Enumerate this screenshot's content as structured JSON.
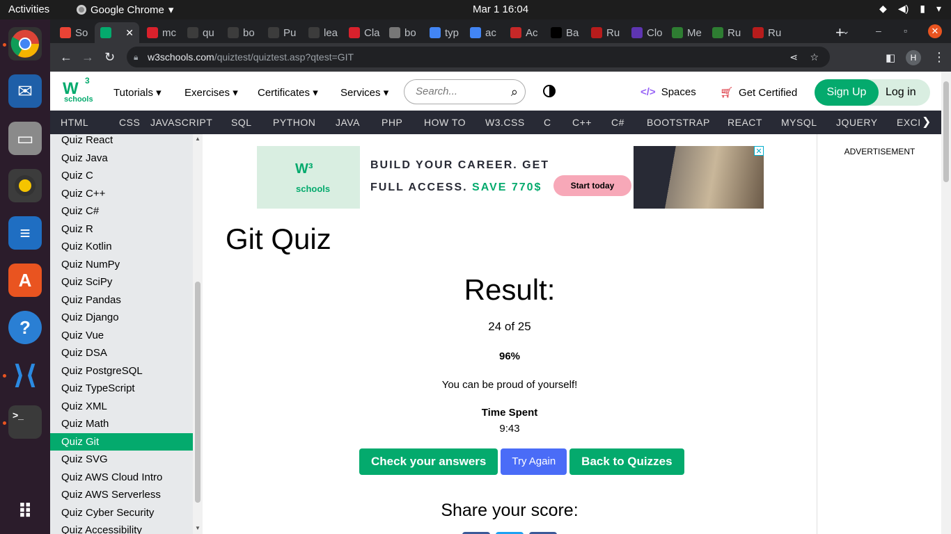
{
  "os_bar": {
    "activities": "Activities",
    "app_name": "Google Chrome",
    "clock": "Mar 1  16:04"
  },
  "dock": {
    "items": [
      "chrome",
      "thunderbird",
      "files",
      "rhythmbox",
      "writer",
      "app-center",
      "help",
      "vscode",
      "terminal",
      "show-apps"
    ]
  },
  "tabs": [
    {
      "label": "So",
      "icon": "gmail-icon",
      "color": "#ea4335"
    },
    {
      "label": "",
      "icon": "w3schools-icon",
      "color": "#04aa6d",
      "active": true
    },
    {
      "label": "mc",
      "icon": "red-cap-icon",
      "color": "#d9212c"
    },
    {
      "label": "qu",
      "icon": "github-icon",
      "color": "#3c3c3c"
    },
    {
      "label": "bo",
      "icon": "github-icon",
      "color": "#3c3c3c"
    },
    {
      "label": "Pu",
      "icon": "github-icon",
      "color": "#3c3c3c"
    },
    {
      "label": "lea",
      "icon": "github-icon",
      "color": "#3c3c3c"
    },
    {
      "label": "Cla",
      "icon": "red-cap-icon",
      "color": "#d9212c"
    },
    {
      "label": "bo",
      "icon": "globe-icon",
      "color": "#777777"
    },
    {
      "label": "typ",
      "icon": "google-icon",
      "color": "#4285f4"
    },
    {
      "label": "ac",
      "icon": "google-icon",
      "color": "#4285f4"
    },
    {
      "label": "Ac",
      "icon": "red-leaf-icon",
      "color": "#c62828"
    },
    {
      "label": "Ba",
      "icon": "medium-icon",
      "color": "#000000"
    },
    {
      "label": "Ru",
      "icon": "rust-icon",
      "color": "#b71c1c"
    },
    {
      "label": "Clo",
      "icon": "claude-icon",
      "color": "#5e35b1"
    },
    {
      "label": "Me",
      "icon": "infinity-icon",
      "color": "#2e7d32"
    },
    {
      "label": "Ru",
      "icon": "infinity-icon",
      "color": "#2e7d32"
    },
    {
      "label": "Ru",
      "icon": "rust-icon",
      "color": "#b71c1c"
    }
  ],
  "omnibox": {
    "host": "w3schools.com",
    "path": "/quiztest/quiztest.asp?qtest=GIT",
    "profile_initial": "H"
  },
  "w3nav": {
    "logo_text": "schools",
    "logo_super": "3",
    "menu": [
      "Tutorials",
      "Exercises",
      "Certificates",
      "Services"
    ],
    "search_placeholder": "Search...",
    "spaces": "Spaces",
    "get_certified": "Get Certified",
    "sign_up": "Sign Up",
    "log_in": "Log in"
  },
  "topics": [
    "HTML",
    "CSS",
    "JAVASCRIPT",
    "SQL",
    "PYTHON",
    "JAVA",
    "PHP",
    "HOW TO",
    "W3.CSS",
    "C",
    "C++",
    "C#",
    "BOOTSTRAP",
    "REACT",
    "MYSQL",
    "JQUERY",
    "EXCI"
  ],
  "sidebar": {
    "items": [
      "Quiz React",
      "Quiz Java",
      "Quiz C",
      "Quiz C++",
      "Quiz C#",
      "Quiz R",
      "Quiz Kotlin",
      "Quiz NumPy",
      "Quiz SciPy",
      "Quiz Pandas",
      "Quiz Django",
      "Quiz Vue",
      "Quiz DSA",
      "Quiz PostgreSQL",
      "Quiz TypeScript",
      "Quiz XML",
      "Quiz Math",
      "Quiz Git",
      "Quiz SVG",
      "Quiz AWS Cloud Intro",
      "Quiz AWS Serverless",
      "Quiz Cyber Security",
      "Quiz Accessibility"
    ],
    "active_index": 17
  },
  "ad": {
    "line1": "BUILD YOUR CAREER. GET",
    "line2_prefix": "FULL ACCESS.",
    "line2_save": "SAVE 770$",
    "cta": "Start today",
    "logo_text": "schools"
  },
  "quiz": {
    "title": "Git Quiz",
    "result_heading": "Result:",
    "score": "24 of 25",
    "percent": "96%",
    "message": "You can be proud of yourself!",
    "time_label": "Time Spent",
    "time_value": "9:43",
    "check_button": "Check your answers",
    "try_again_button": "Try Again",
    "back_button": "Back to Quizzes",
    "share_heading": "Share your score:"
  },
  "right_column": {
    "advertisement_label": "ADVERTISEMENT"
  }
}
